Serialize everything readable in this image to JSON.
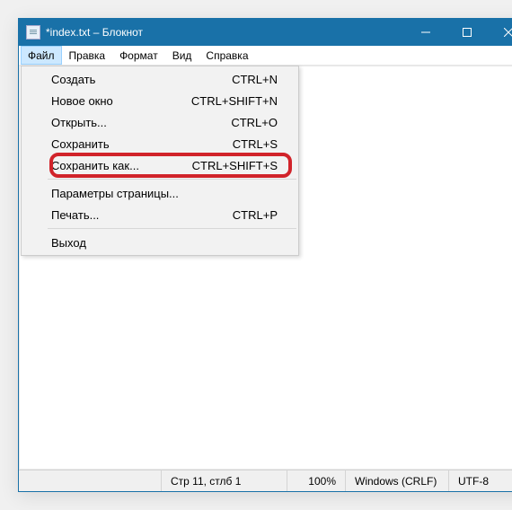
{
  "window": {
    "title": "*index.txt – Блокнот"
  },
  "menubar": {
    "items": [
      {
        "label": "Файл",
        "name": "menu-file",
        "active": true
      },
      {
        "label": "Правка",
        "name": "menu-edit",
        "active": false
      },
      {
        "label": "Формат",
        "name": "menu-format",
        "active": false
      },
      {
        "label": "Вид",
        "name": "menu-view",
        "active": false
      },
      {
        "label": "Справка",
        "name": "menu-help",
        "active": false
      }
    ]
  },
  "file_menu": {
    "groups": [
      [
        {
          "label": "Создать",
          "shortcut": "CTRL+N",
          "name": "menu-new"
        },
        {
          "label": "Новое окно",
          "shortcut": "CTRL+SHIFT+N",
          "name": "menu-new-window"
        },
        {
          "label": "Открыть...",
          "shortcut": "CTRL+O",
          "name": "menu-open"
        },
        {
          "label": "Сохранить",
          "shortcut": "CTRL+S",
          "name": "menu-save"
        },
        {
          "label": "Сохранить как...",
          "shortcut": "CTRL+SHIFT+S",
          "name": "menu-save-as",
          "highlight": true
        }
      ],
      [
        {
          "label": "Параметры страницы...",
          "shortcut": "",
          "name": "menu-page-setup"
        },
        {
          "label": "Печать...",
          "shortcut": "CTRL+P",
          "name": "menu-print"
        }
      ],
      [
        {
          "label": "Выход",
          "shortcut": "",
          "name": "menu-exit"
        }
      ]
    ]
  },
  "statusbar": {
    "position": "Стр 11, стлб 1",
    "zoom": "100%",
    "eol": "Windows (CRLF)",
    "encoding": "UTF-8"
  }
}
